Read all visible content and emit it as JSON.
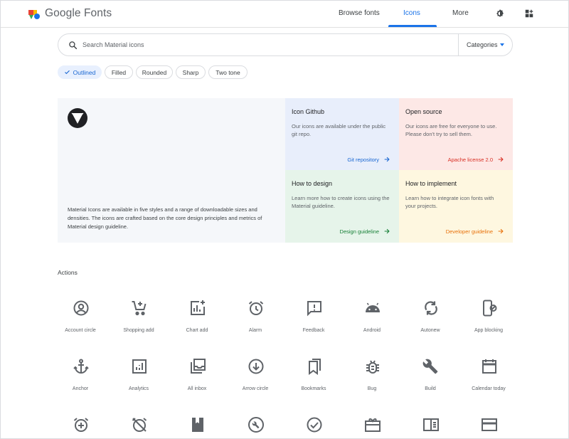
{
  "header": {
    "brand": "Google Fonts",
    "nav": {
      "browse_fonts": "Browse fonts",
      "icons": "Icons",
      "more": "More"
    },
    "icons": [
      "theme-toggle-icon",
      "apps-grid-icon"
    ]
  },
  "search": {
    "placeholder": "Search Material icons",
    "categories_label": "Categories"
  },
  "styles": {
    "outlined": "Outlined",
    "filled": "Filled",
    "rounded": "Rounded",
    "sharp": "Sharp",
    "two_tone": "Two tone",
    "selected": "Outlined"
  },
  "hero": {
    "description": "Material Icons are available in five styles and a range of downloadable sizes and densities. The icons are crafted based on the core design principles and metrics of Material design guideline.",
    "cards": {
      "github": {
        "title": "Icon Github",
        "text": "Our icons are available under the public git repo.",
        "link": "Git repository",
        "color": "#1967d2",
        "bg": "#e8eefb"
      },
      "open_source": {
        "title": "Open source",
        "text": "Our icons are free for everyone to use. Please don't try to sell them.",
        "link": "Apache license 2.0",
        "color": "#d93025",
        "bg": "#fde8e6"
      },
      "design": {
        "title": "How to design",
        "text": "Learn more how to create icons using the Material guideline.",
        "link": "Design guideline",
        "color": "#188038",
        "bg": "#e6f4ea"
      },
      "implement": {
        "title": "How to implement",
        "text": "Learn how to integrate icon fonts with your projects.",
        "link": "Developer guideline",
        "color": "#e8710a",
        "bg": "#fef7e0"
      }
    }
  },
  "section": {
    "title": "Actions"
  },
  "icons": {
    "account_circle": "Account circle",
    "shopping_add": "Shopping add",
    "chart_add": "Chart add",
    "alarm": "Alarm",
    "feedback": "Feedback",
    "android": "Android",
    "autorenew": "Autonew",
    "app_blocking": "App blocking",
    "anchor": "Anchor",
    "analytics": "Analytics",
    "all_inbox": "All inbox",
    "arrow_circle": "Arrow circle",
    "bookmarks": "Bookmarks",
    "bug": "Bug",
    "build": "Build",
    "calendar_today": "Calendar today"
  },
  "colors": {
    "accent": "#1a73e8",
    "icon": "#5f6368"
  }
}
